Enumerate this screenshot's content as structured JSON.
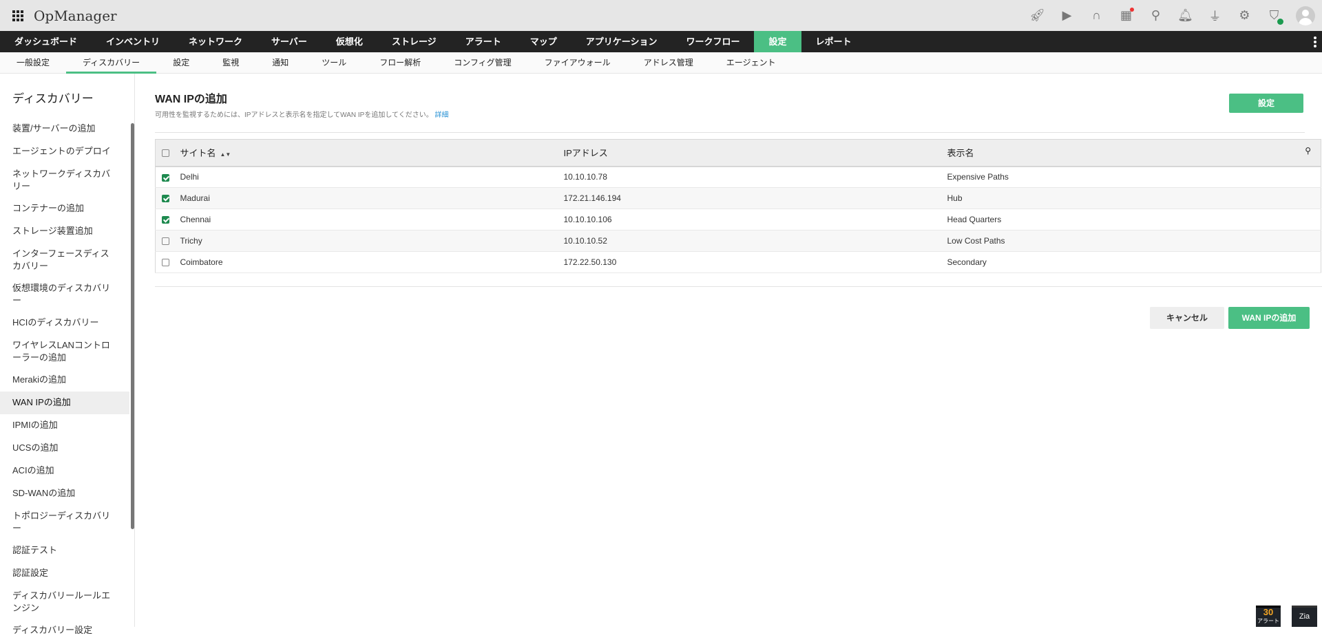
{
  "app": {
    "title": "OpManager"
  },
  "top_icons": [
    "rocket-icon",
    "presentation-icon",
    "headset-icon",
    "gift-icon",
    "search-icon",
    "bell-icon",
    "plug-icon",
    "gear-icon",
    "shield-alert-icon",
    "user-avatar"
  ],
  "nav": [
    "ダッシュボード",
    "インベントリ",
    "ネットワーク",
    "サーバー",
    "仮想化",
    "ストレージ",
    "アラート",
    "マップ",
    "アプリケーション",
    "ワークフロー",
    "設定",
    "レポート"
  ],
  "subnav": [
    "一般設定",
    "ディスカバリー",
    "設定",
    "監視",
    "通知",
    "ツール",
    "フロー解析",
    "コンフィグ管理",
    "ファイアウォール",
    "アドレス管理",
    "エージェント"
  ],
  "sidebar": {
    "title": "ディスカバリー",
    "items": [
      "装置/サーバーの追加",
      "エージェントのデプロイ",
      "ネットワークディスカバリー",
      "コンテナーの追加",
      "ストレージ装置追加",
      "インターフェースディスカバリー",
      "仮想環境のディスカバリー",
      "HCIのディスカバリー",
      "ワイヤレスLANコントローラーの追加",
      "Merakiの追加",
      "WAN IPの追加",
      "IPMIの追加",
      "UCSの追加",
      "ACIの追加",
      "SD-WANの追加",
      "トポロジーディスカバリー",
      "認証テスト",
      "認証設定",
      "ディスカバリールールエンジン",
      "ディスカバリー設定"
    ]
  },
  "main": {
    "title": "WAN IPの追加",
    "description": "可用性を監視するためには、IPアドレスと表示名を指定してWAN IPを追加してください。",
    "details_link": "詳細",
    "settings_button": "設定",
    "cancel_button": "キャンセル",
    "add_button": "WAN IPの追加"
  },
  "table": {
    "headers": [
      "サイト名",
      "IPアドレス",
      "表示名"
    ],
    "rows": [
      {
        "checked": true,
        "site": "Delhi",
        "ip": "10.10.10.78",
        "name": "Expensive Paths"
      },
      {
        "checked": true,
        "site": "Madurai",
        "ip": "172.21.146.194",
        "name": "Hub"
      },
      {
        "checked": true,
        "site": "Chennai",
        "ip": "10.10.10.106",
        "name": "Head Quarters"
      },
      {
        "checked": false,
        "site": "Trichy",
        "ip": "10.10.10.52",
        "name": "Low Cost Paths"
      },
      {
        "checked": false,
        "site": "Coimbatore",
        "ip": "172.22.50.130",
        "name": "Secondary"
      }
    ]
  },
  "widgets": {
    "alert_count": "30",
    "alert_label": "アラート",
    "zia_label": "Zia"
  },
  "colors": {
    "accent": "#4bbf84",
    "nav_bg": "#232323",
    "link": "#2a93d5"
  }
}
